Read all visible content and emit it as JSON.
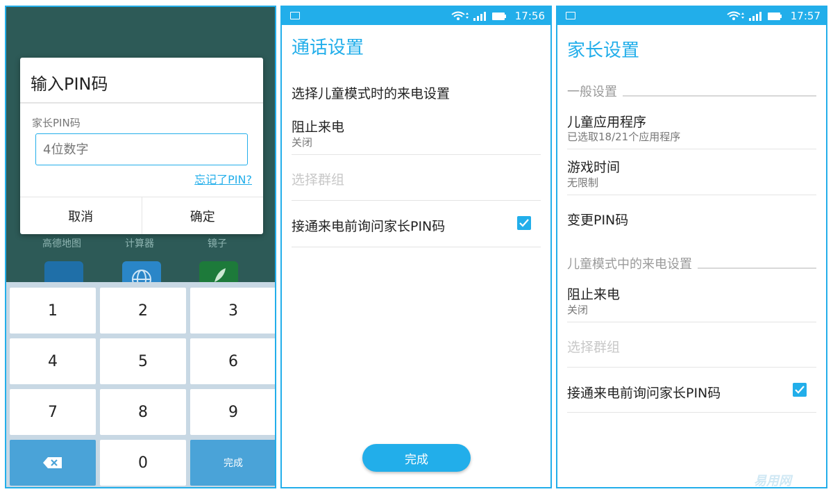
{
  "panel1": {
    "home_labels": [
      "高德地图",
      "计算器",
      "镜子"
    ],
    "dialog": {
      "title": "输入PIN码",
      "field_label": "家长PIN码",
      "placeholder": "4位数字",
      "forgot_link": "忘记了PIN?",
      "cancel": "取消",
      "confirm": "确定"
    },
    "keypad": {
      "keys": [
        "1",
        "2",
        "3",
        "4",
        "5",
        "6",
        "7",
        "8",
        "9",
        "0"
      ],
      "done": "完成"
    }
  },
  "panel2": {
    "status_time": "17:56",
    "title": "通话设置",
    "header": "选择儿童模式时的来电设置",
    "block_calls": {
      "title": "阻止来电",
      "value": "关闭"
    },
    "select_group": "选择群组",
    "ask_pin": {
      "label": "接通来电前询问家长PIN码",
      "checked": true
    },
    "done_button": "完成"
  },
  "panel3": {
    "status_time": "17:57",
    "title": "家长设置",
    "section_general": "一般设置",
    "kids_apps": {
      "title": "儿童应用程序",
      "subtitle": "已选取18/21个应用程序"
    },
    "play_time": {
      "title": "游戏时间",
      "subtitle": "无限制"
    },
    "change_pin": "变更PIN码",
    "section_calls": "儿童模式中的来电设置",
    "block_calls": {
      "title": "阻止来电",
      "value": "关闭"
    },
    "select_group": "选择群组",
    "ask_pin": {
      "label": "接通来电前询问家长PIN码",
      "checked": true
    }
  },
  "colors": {
    "accent": "#22aeea",
    "keypad_bg": "#c8d8e4",
    "home_bg": "#2d5a57"
  },
  "watermark": "易用网"
}
